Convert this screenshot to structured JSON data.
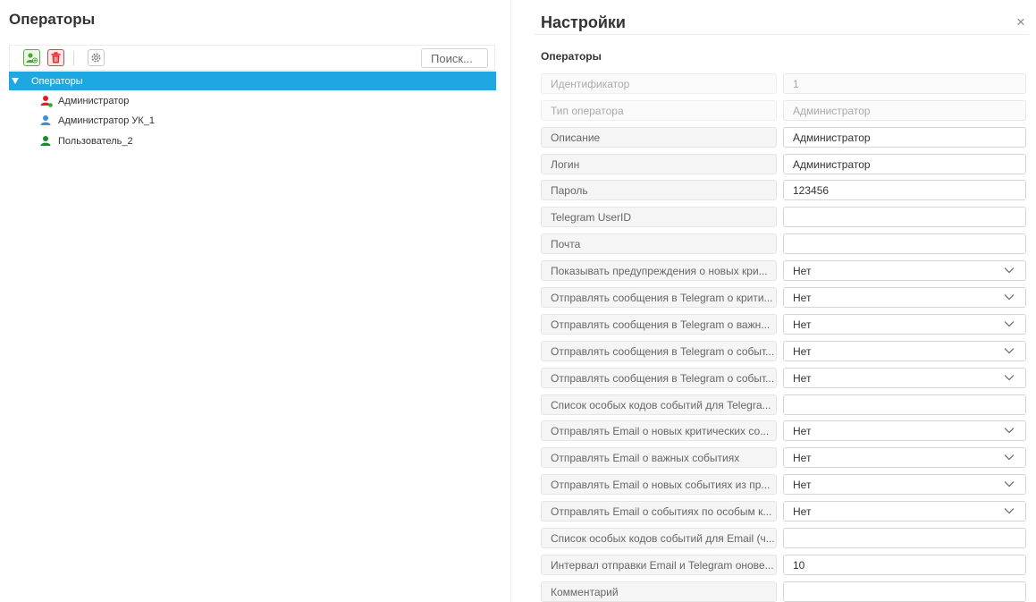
{
  "left": {
    "title": "Операторы",
    "search_placeholder": "Поиск...",
    "tree": {
      "root_label": "Операторы",
      "items": [
        {
          "label": "Администратор",
          "color": "#e02020"
        },
        {
          "label": "Администратор УК_1",
          "color": "#3b8fdc"
        },
        {
          "label": "Пользователь_2",
          "color": "#1a8a2e"
        }
      ]
    }
  },
  "right": {
    "title": "Настройки",
    "close_symbol": "×",
    "section": "Операторы",
    "fields": [
      {
        "label": "Идентификатор",
        "value": "1"
      },
      {
        "label": "Тип оператора",
        "value": "Администратор"
      },
      {
        "label": "Описание",
        "value": "Администратор"
      },
      {
        "label": "Логин",
        "value": "Администратор"
      },
      {
        "label": "Пароль",
        "value": "123456"
      },
      {
        "label": "Telegram UserID",
        "value": ""
      },
      {
        "label": "Почта",
        "value": ""
      },
      {
        "label": "Показывать предупреждения о новых кри...",
        "value": "Нет"
      },
      {
        "label": "Отправлять сообщения в Telegram о крити...",
        "value": "Нет"
      },
      {
        "label": "Отправлять сообщения в Telegram о важн...",
        "value": "Нет"
      },
      {
        "label": "Отправлять сообщения в Telegram о событ...",
        "value": "Нет"
      },
      {
        "label": "Отправлять сообщения в Telegram о событ...",
        "value": "Нет"
      },
      {
        "label": "Список особых кодов событий для Telegra...",
        "value": ""
      },
      {
        "label": "Отправлять Email о новых критических со...",
        "value": "Нет"
      },
      {
        "label": "Отправлять Email о важных событиях",
        "value": "Нет"
      },
      {
        "label": "Отправлять Email о новых событиях из пр...",
        "value": "Нет"
      },
      {
        "label": "Отправлять Email о событиях по особым к...",
        "value": "Нет"
      },
      {
        "label": "Список особых кодов событий для Email (ч...",
        "value": ""
      },
      {
        "label": "Интервал отправки Email и Telegram онове...",
        "value": "10"
      },
      {
        "label": "Комментарий",
        "value": ""
      }
    ]
  },
  "colors": {
    "accent": "#1ea7e1",
    "add_green": "#55b33b",
    "delete_red": "#e04040"
  }
}
